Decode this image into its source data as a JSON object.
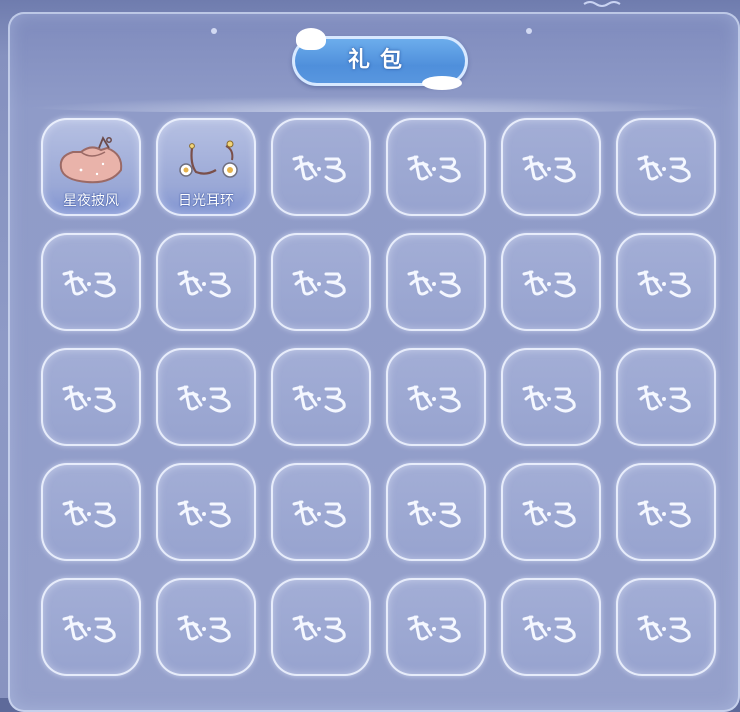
{
  "header": {
    "title": "礼包"
  },
  "colors": {
    "panel": "#8f9bc8",
    "title_pill": "#4f8fdb",
    "slot": "#9aa6d2",
    "accent_label_shadow": "#3b56a5"
  },
  "items": [
    {
      "label": "星夜披风",
      "icon": "cape-icon",
      "filled": true
    },
    {
      "label": "日光耳环",
      "icon": "earring-icon",
      "filled": true
    }
  ],
  "empty_slot": {
    "icon": "guangyu-logo-icon",
    "count": 28
  }
}
